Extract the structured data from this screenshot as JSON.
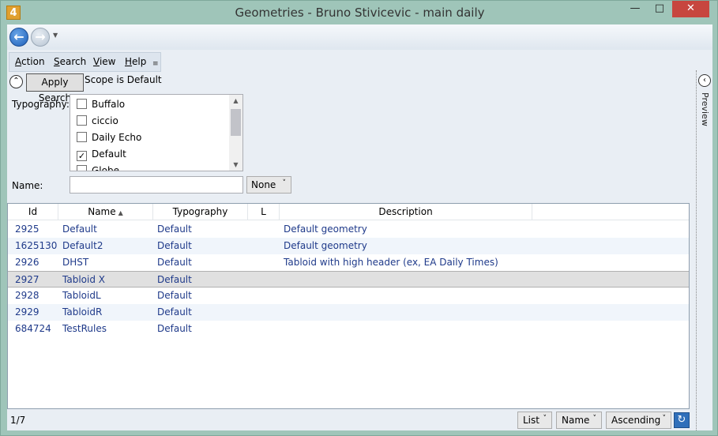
{
  "window": {
    "title": "Geometries - Bruno Stivicevic - main daily",
    "app_icon": "4",
    "minimize_glyph": "—",
    "maximize_glyph": "□",
    "close_glyph": "✕"
  },
  "nav": {
    "back_glyph": "←",
    "forward_glyph": "→",
    "dropdown_glyph": "▼"
  },
  "menu": {
    "items": [
      {
        "label_underline": "A",
        "label_rest": "ction"
      },
      {
        "label_underline": "S",
        "label_rest": "earch"
      },
      {
        "label_underline": "V",
        "label_rest": "iew"
      },
      {
        "label_underline": "H",
        "label_rest": "elp"
      }
    ],
    "overflow_glyph": "≡"
  },
  "search_panel": {
    "collapse_glyph": "⌃",
    "apply_label": "Apply Search",
    "scope_text": "Scope is Default",
    "typography_label": "Typography:",
    "typographies": [
      {
        "label": "Buffalo",
        "checked": false
      },
      {
        "label": "ciccio",
        "checked": false
      },
      {
        "label": "Daily Echo",
        "checked": false
      },
      {
        "label": "Default",
        "checked": true
      },
      {
        "label": "Globe",
        "checked": false
      }
    ],
    "name_label": "Name:",
    "name_value": "",
    "name_mode": "None"
  },
  "grid": {
    "columns": [
      "Id",
      "Name",
      "Typography",
      "L",
      "Description"
    ],
    "sorted_by": "Name",
    "sort_direction": "ascending",
    "rows": [
      {
        "id": "2925",
        "name": "Default",
        "typography": "Default",
        "l": "",
        "description": "Default geometry"
      },
      {
        "id": "1625130",
        "name": "Default2",
        "typography": "Default",
        "l": "",
        "description": "Default geometry"
      },
      {
        "id": "2926",
        "name": "DHST",
        "typography": "Default",
        "l": "",
        "description": "Tabloid with high header (ex, EA Daily Times)"
      },
      {
        "id": "2927",
        "name": "Tabloid X",
        "typography": "Default",
        "l": "",
        "description": ""
      },
      {
        "id": "2928",
        "name": "TabloidL",
        "typography": "Default",
        "l": "",
        "description": ""
      },
      {
        "id": "2929",
        "name": "TabloidR",
        "typography": "Default",
        "l": "",
        "description": ""
      },
      {
        "id": "684724",
        "name": "TestRules",
        "typography": "Default",
        "l": "",
        "description": ""
      }
    ],
    "selected_row": 3
  },
  "status": {
    "count": "1/7",
    "view_mode": "List",
    "sort_field": "Name",
    "sort_order": "Ascending",
    "chevron_glyph": "˅",
    "refresh_glyph": "↻"
  },
  "preview": {
    "label": "Preview",
    "collapse_glyph": "‹"
  },
  "colors": {
    "window_frame": "#9fc5b9",
    "row_text": "#1f3a8a",
    "close_button": "#c7463f"
  }
}
